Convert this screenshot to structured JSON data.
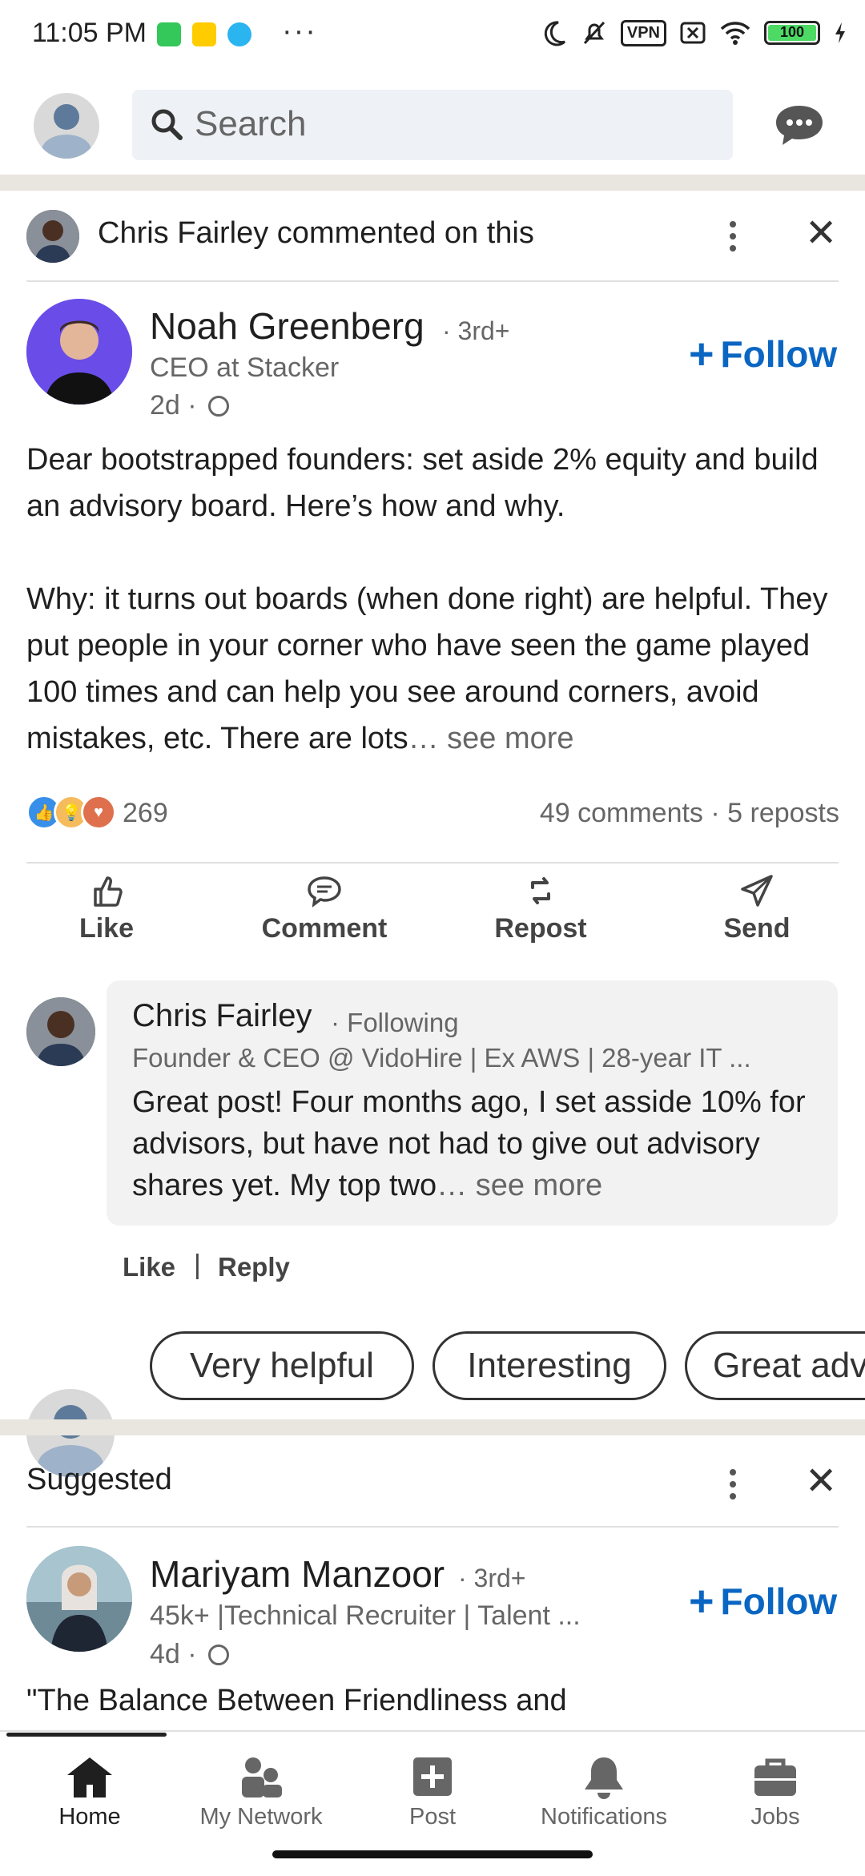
{
  "status_bar": {
    "time": "11:05 PM",
    "dots": "···",
    "vpn": "VPN",
    "battery": "100"
  },
  "top_bar": {
    "search_placeholder": "Search"
  },
  "activity": {
    "actor": "Chris Fairley",
    "action": " commented on this"
  },
  "post": {
    "author_name": "Noah Greenberg",
    "degree": "· 3rd+",
    "title": "CEO at Stacker",
    "age": "2d ·",
    "follow_label": "Follow",
    "body_p1": "Dear bootstrapped founders: set aside 2% equity and build an advisory board. Here’s how and why.",
    "body_p2": "Why: it turns out boards (when done right) are helpful. They put people in your corner who have seen the game played 100 times and can help you see around corners, avoid mistakes, etc. There are lots",
    "see_more": "… see more",
    "reaction_count": "269",
    "engagement": "49 comments · 5 reposts"
  },
  "actions": [
    {
      "label": "Like"
    },
    {
      "label": "Comment"
    },
    {
      "label": "Repost"
    },
    {
      "label": "Send"
    }
  ],
  "comment": {
    "name": "Chris Fairley",
    "following": "· Following",
    "headline": "Founder & CEO @ VidoHire | Ex AWS | 28-year IT ...",
    "text": "Great post! Four months ago, I set asside 10% for advisors, but have not had to give out advisory shares yet. My top two",
    "see_more": "… see more",
    "like": "Like",
    "sep": "|",
    "reply": "Reply"
  },
  "quick_replies": [
    "Very helpful",
    "Interesting",
    "Great advice"
  ],
  "suggested": {
    "label": "Suggested",
    "name": "Mariyam Manzoor",
    "degree": "· 3rd+",
    "title": "45k+ |Technical Recruiter | Talent ...",
    "age": "4d ·",
    "follow_label": "Follow",
    "post_start": "\"The Balance Between Friendliness and"
  },
  "nav": [
    {
      "label": "Home",
      "icon": "home-icon"
    },
    {
      "label": "My Network",
      "icon": "network-icon"
    },
    {
      "label": "Post",
      "icon": "post-icon"
    },
    {
      "label": "Notifications",
      "icon": "bell-icon"
    },
    {
      "label": "Jobs",
      "icon": "briefcase-icon"
    }
  ],
  "colors": {
    "accent": "#0a66c2",
    "divider": "#e9e5df"
  }
}
